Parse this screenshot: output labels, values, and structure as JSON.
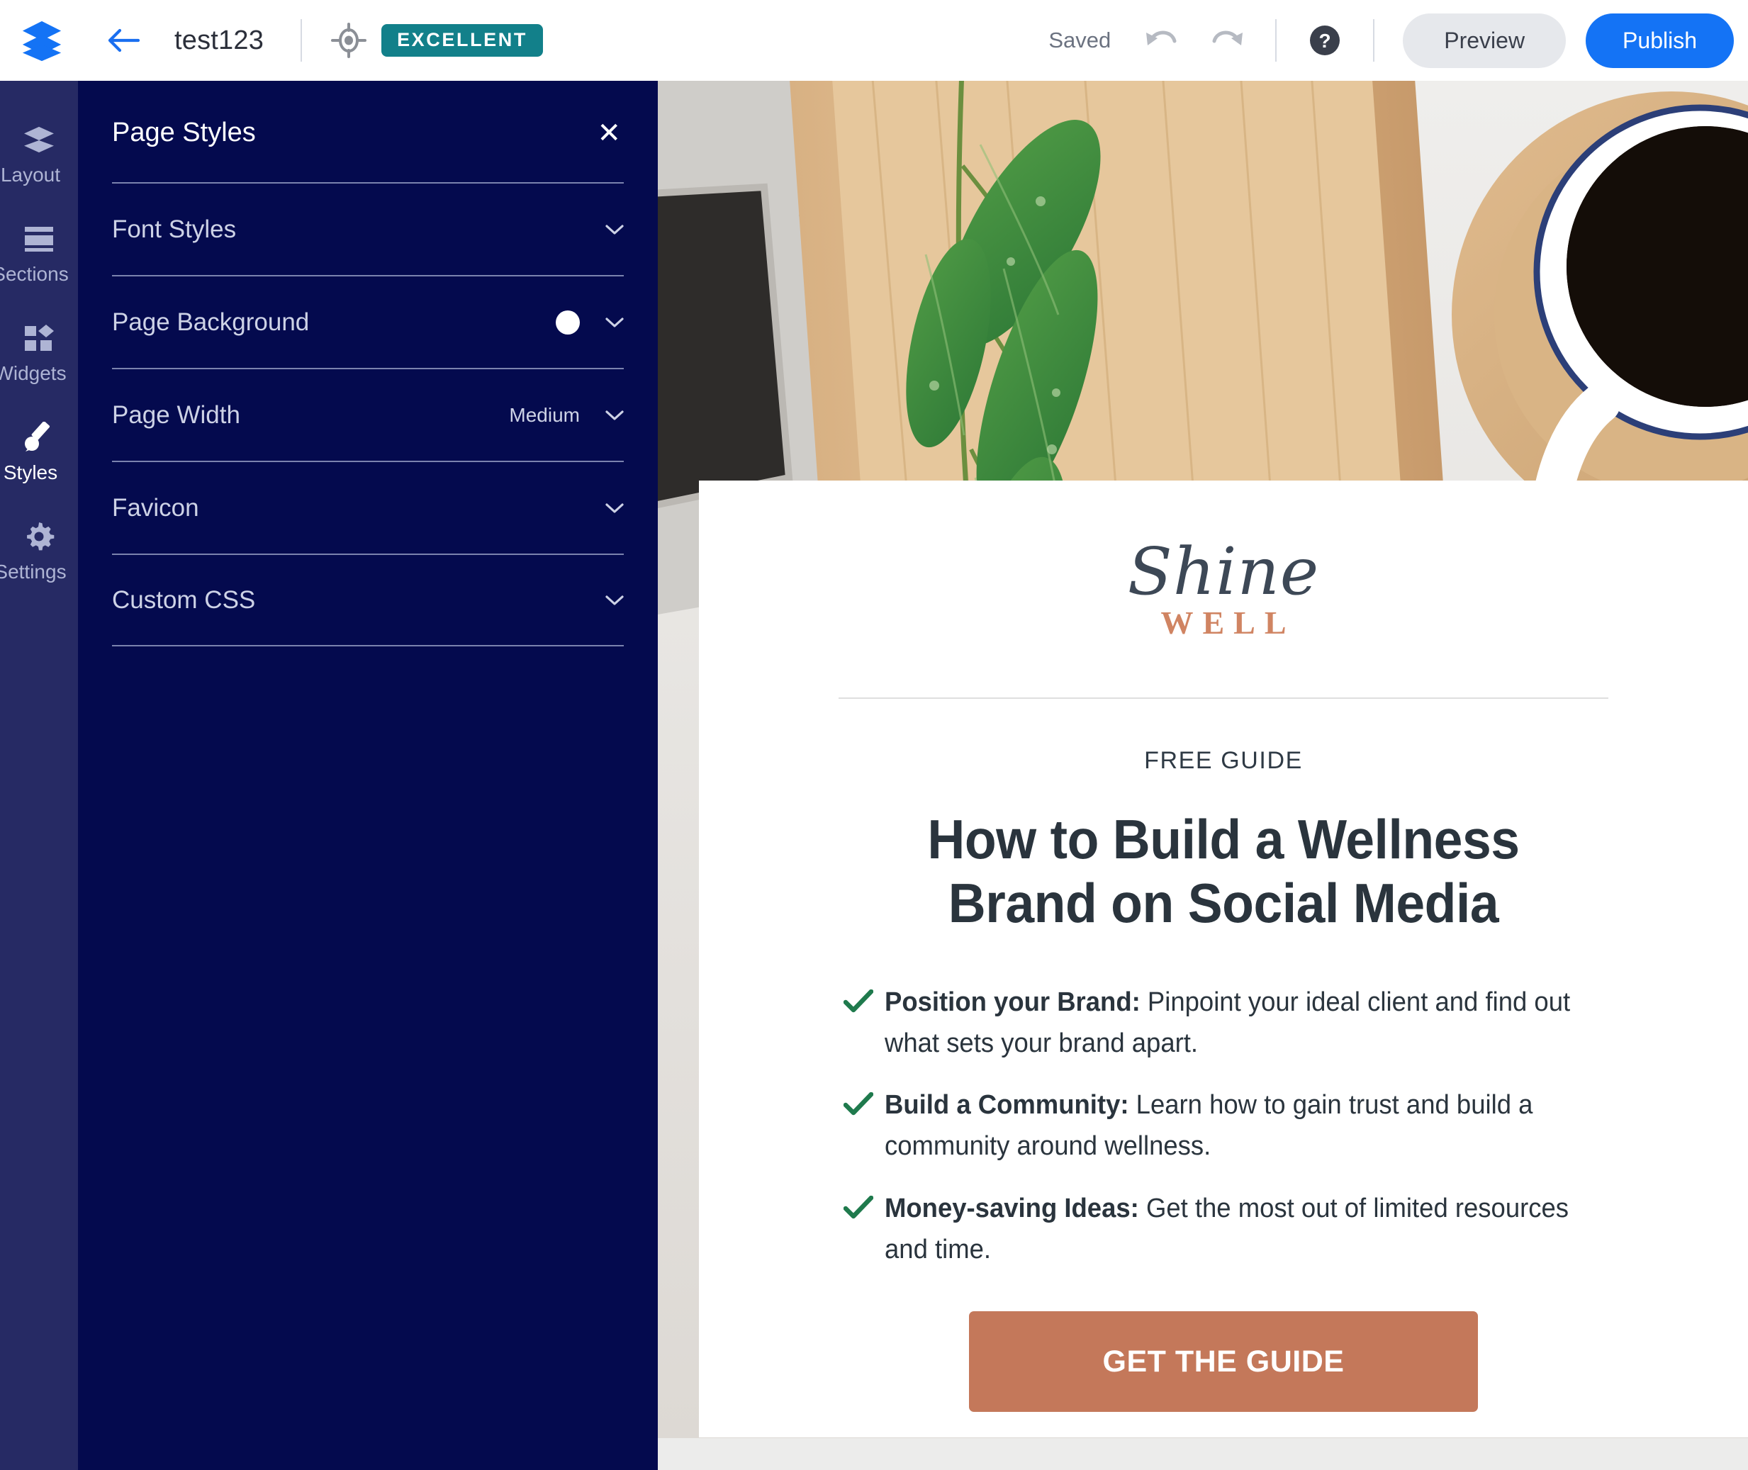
{
  "topbar": {
    "logo_icon": "stacked-layers-logo",
    "back_icon": "arrow-left-icon",
    "site_title": "test123",
    "score_icon": "target-icon",
    "score_badge": "EXCELLENT",
    "saved_label": "Saved",
    "undo_icon": "undo-icon",
    "redo_icon": "redo-icon",
    "help_icon": "help-circle-icon",
    "preview_label": "Preview",
    "publish_label": "Publish",
    "accent_blue": "#1473f5",
    "badge_teal": "#12808a"
  },
  "rail": {
    "items": [
      {
        "label": "Layout",
        "icon": "layers-icon",
        "active": false
      },
      {
        "label": "Sections",
        "icon": "sections-icon",
        "active": false
      },
      {
        "label": "Widgets",
        "icon": "widgets-icon",
        "active": false
      },
      {
        "label": "Styles",
        "icon": "paintbrush-icon",
        "active": true
      },
      {
        "label": "Settings",
        "icon": "gear-icon",
        "active": false
      }
    ]
  },
  "panel": {
    "title": "Page Styles",
    "close_icon": "close-icon",
    "close_label": "✕",
    "rows": [
      {
        "label": "Font Styles",
        "value": "",
        "swatch": ""
      },
      {
        "label": "Page Background",
        "value": "",
        "swatch": "#ffffff"
      },
      {
        "label": "Page Width",
        "value": "Medium",
        "swatch": ""
      },
      {
        "label": "Favicon",
        "value": "",
        "swatch": ""
      },
      {
        "label": "Custom CSS",
        "value": "",
        "swatch": ""
      }
    ],
    "background_color": "#040a4e"
  },
  "preview": {
    "hero_alt": "wooden tray with eucalyptus leaves and a cup of black coffee on a white desk",
    "logo": {
      "script_word": "Shine",
      "block_word": "WELL",
      "script_color": "#3d4856",
      "block_color": "#d08462"
    },
    "eyebrow": "FREE GUIDE",
    "headline_line1": "How to Build a Wellness",
    "headline_line2": "Brand on Social Media",
    "bullets": [
      {
        "lead": "Position your Brand:",
        "text": " Pinpoint your ideal client and find out what sets your brand apart."
      },
      {
        "lead": "Build a Community:",
        "text": " Learn how to gain trust and build a community around wellness."
      },
      {
        "lead": "Money-saving Ideas:",
        "text": " Get the most out of limited resources and time."
      }
    ],
    "check_icon": "check-icon",
    "check_color": "#1f7a4d",
    "cta_label": "GET THE GUIDE",
    "cta_color": "#c4785a"
  }
}
